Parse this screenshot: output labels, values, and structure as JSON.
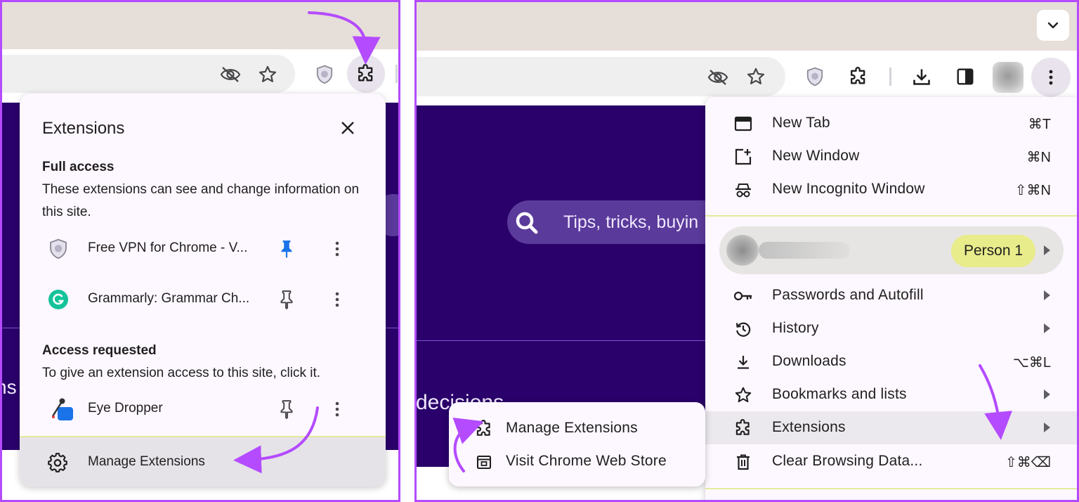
{
  "extensions_popup": {
    "title": "Extensions",
    "full_access": {
      "heading": "Full access",
      "description": "These extensions can see and change information on this site.",
      "items": [
        {
          "name": "Free VPN for Chrome - V...",
          "icon": "vpn-shield-icon",
          "pinned": true
        },
        {
          "name": "Grammarly: Grammar Ch...",
          "icon": "grammarly-icon",
          "pinned": false
        }
      ]
    },
    "access_requested": {
      "heading": "Access requested",
      "description": "To give an extension access to this site, click it.",
      "items": [
        {
          "name": "Eye Dropper",
          "icon": "eye-dropper-icon",
          "pinned": false
        }
      ]
    },
    "manage_label": "Manage Extensions"
  },
  "left_page": {
    "partial_text": "ns"
  },
  "right_page": {
    "search_placeholder": "Tips, tricks, buyin",
    "partial_text": "decisions"
  },
  "chrome_menu": {
    "group1": [
      {
        "label": "New Tab",
        "shortcut": "⌘T",
        "icon": "new-tab-icon"
      },
      {
        "label": "New Window",
        "shortcut": "⌘N",
        "icon": "new-window-icon"
      },
      {
        "label": "New Incognito Window",
        "shortcut": "⇧⌘N",
        "icon": "incognito-icon"
      }
    ],
    "profile": {
      "badge": "Person 1"
    },
    "group2": [
      {
        "label": "Passwords and Autofill",
        "shortcut": "",
        "icon": "key-icon",
        "submenu": true
      },
      {
        "label": "History",
        "shortcut": "",
        "icon": "history-icon",
        "submenu": true
      },
      {
        "label": "Downloads",
        "shortcut": "⌥⌘L",
        "icon": "download-icon",
        "submenu": false
      },
      {
        "label": "Bookmarks and lists",
        "shortcut": "",
        "icon": "star-icon",
        "submenu": true
      },
      {
        "label": "Extensions",
        "shortcut": "",
        "icon": "puzzle-icon",
        "submenu": true
      },
      {
        "label": "Clear Browsing Data...",
        "shortcut": "⇧⌘⌫",
        "icon": "trash-icon",
        "submenu": false
      }
    ]
  },
  "extensions_submenu": [
    {
      "label": "Manage Extensions",
      "icon": "puzzle-icon"
    },
    {
      "label": "Visit Chrome Web Store",
      "icon": "web-store-icon"
    }
  ],
  "colors": {
    "accent_arrow": "#b44bff",
    "page_background": "#2a006a",
    "menu_background": "#fdf7ff",
    "person_badge": "#e8ec8a",
    "pin_active": "#1a73e8"
  }
}
